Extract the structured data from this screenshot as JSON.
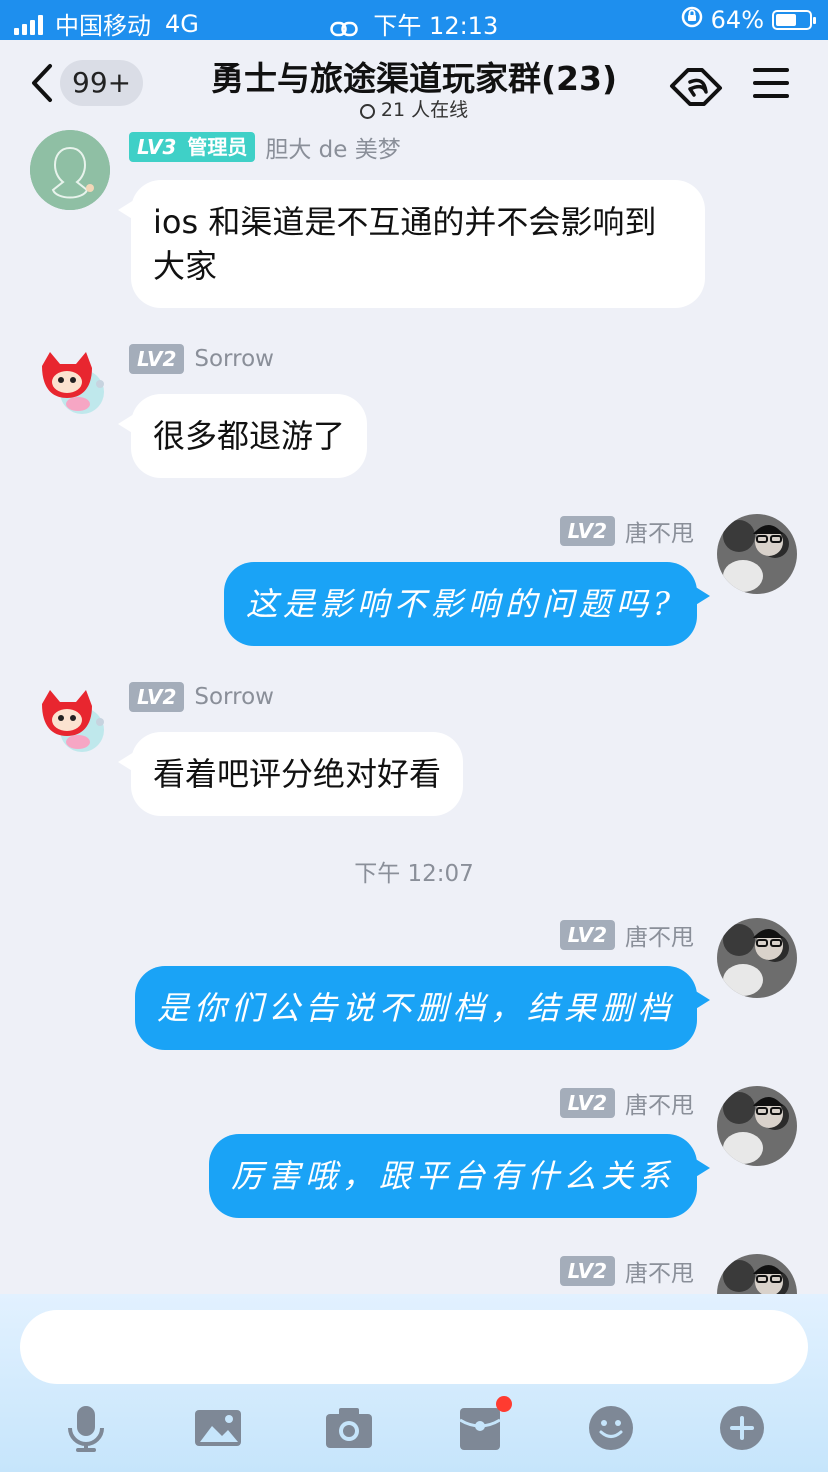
{
  "status_bar": {
    "carrier": "中国移动",
    "network": "4G",
    "time": "下午 12:13",
    "battery": "64%",
    "battery_level": 0.64
  },
  "header": {
    "unread_badge": "99+",
    "group_title": "勇士与旅途渠道玩家群(23)",
    "online_text": "21 人在线"
  },
  "messages": [
    {
      "side": "in",
      "level": "LV3",
      "role": "管理员",
      "sender": "胆大 de 美梦",
      "text": "ios 和渠道是不互通的并不会影响到大家"
    },
    {
      "side": "in",
      "level": "LV2",
      "sender": "Sorrow",
      "text": "很多都退游了"
    },
    {
      "side": "out",
      "level": "LV2",
      "sender": "唐不甩",
      "text": "这是影响不影响的问题吗?"
    },
    {
      "side": "in",
      "level": "LV2",
      "sender": "Sorrow",
      "text": "看着吧评分绝对好看"
    },
    {
      "side": "out",
      "level": "LV2",
      "sender": "唐不甩",
      "text": "是你们公告说不删档，结果删档"
    },
    {
      "side": "out",
      "level": "LV2",
      "sender": "唐不甩",
      "text": "厉害哦，跟平台有什么关系"
    },
    {
      "side": "out",
      "level": "LV2",
      "sender": "唐不甩"
    }
  ],
  "timestamp_divider": "下午 12:07",
  "input": {
    "value": "",
    "placeholder": ""
  },
  "toolbar_icons": [
    "microphone-icon",
    "image-icon",
    "camera-icon",
    "red-packet-icon",
    "emoji-icon",
    "plus-icon"
  ],
  "colors": {
    "accent_blue": "#1e8fee",
    "outgoing_bubble": "#1aa3f6",
    "incoming_bubble": "#ffffff",
    "chat_background": "#eef0f7",
    "admin_level_badge": "#3fd0c7",
    "level_badge": "#a4adba",
    "notification_dot": "#ff3b30"
  }
}
